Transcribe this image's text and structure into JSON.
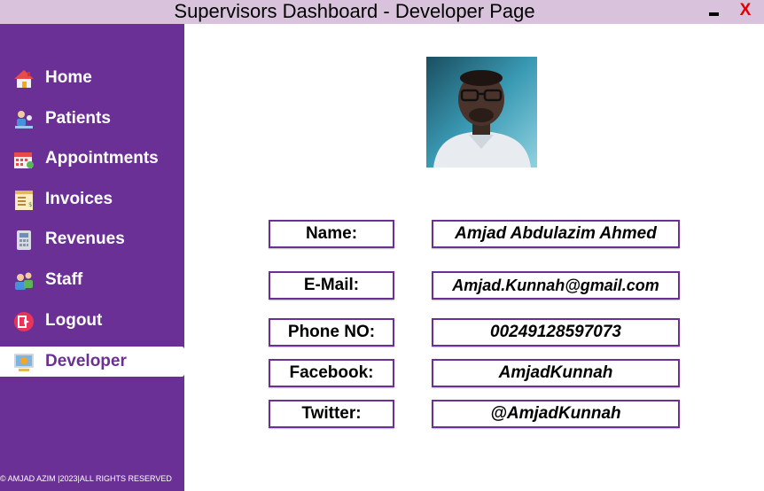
{
  "window": {
    "title": "Supervisors Dashboard - Developer Page",
    "close_label": "X"
  },
  "sidebar": {
    "items": [
      {
        "label": "Home",
        "icon": "home-icon"
      },
      {
        "label": "Patients",
        "icon": "patients-icon"
      },
      {
        "label": "Appointments",
        "icon": "calendar-icon"
      },
      {
        "label": "Invoices",
        "icon": "invoice-icon"
      },
      {
        "label": "Revenues",
        "icon": "revenue-icon"
      },
      {
        "label": "Staff",
        "icon": "staff-icon"
      },
      {
        "label": "Logout",
        "icon": "logout-icon"
      },
      {
        "label": "Developer",
        "icon": "developer-icon",
        "active": true
      }
    ],
    "footer": "© AMJAD AZIM |2023|ALL RIGHTS RESERVED"
  },
  "developer": {
    "fields": [
      {
        "label": "Name:",
        "value": "Amjad Abdulazim Ahmed"
      },
      {
        "label": "E-Mail:",
        "value": "Amjad.Kunnah@gmail.com"
      },
      {
        "label": "Phone NO:",
        "value": "00249128597073"
      },
      {
        "label": "Facebook:",
        "value": "AmjadKunnah"
      },
      {
        "label": "Twitter:",
        "value": "@AmjadKunnah"
      }
    ]
  },
  "colors": {
    "sidebar": "#6a3096",
    "titlebar": "#d9c3dc",
    "close": "#e00000"
  }
}
